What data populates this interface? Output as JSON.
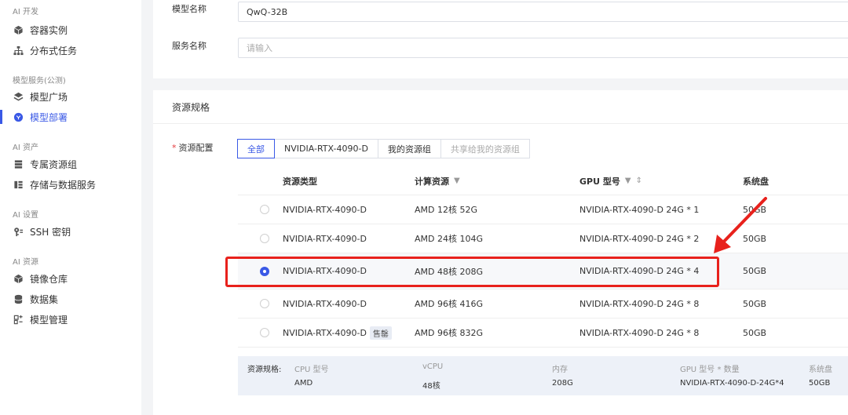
{
  "sidebar": {
    "groups": [
      {
        "label": "AI 开发",
        "items": [
          {
            "label": "容器实例",
            "icon": "cube-icon"
          },
          {
            "label": "分布式任务",
            "icon": "sitemap-icon"
          }
        ]
      },
      {
        "label": "模型服务(公测)",
        "items": [
          {
            "label": "模型广场",
            "icon": "layers-icon"
          },
          {
            "label": "模型部署",
            "icon": "deploy-icon",
            "active": true
          }
        ]
      },
      {
        "label": "AI 资产",
        "items": [
          {
            "label": "专属资源组",
            "icon": "server-icon"
          },
          {
            "label": "存储与数据服务",
            "icon": "storage-icon"
          }
        ]
      },
      {
        "label": "AI 设置",
        "items": [
          {
            "label": "SSH 密钥",
            "icon": "key-icon"
          }
        ]
      },
      {
        "label": "AI 资源",
        "items": [
          {
            "label": "镜像仓库",
            "icon": "box-icon"
          },
          {
            "label": "数据集",
            "icon": "database-icon"
          },
          {
            "label": "模型管理",
            "icon": "model-icon"
          }
        ]
      }
    ]
  },
  "form": {
    "model_name_label": "模型名称",
    "model_name_value": "QwQ-32B",
    "service_name_label": "服务名称",
    "service_name_placeholder": "请输入"
  },
  "resource": {
    "section_title": "资源规格",
    "config_label": "资源配置",
    "tabs": [
      {
        "label": "全部",
        "active": true
      },
      {
        "label": "NVIDIA-RTX-4090-D"
      },
      {
        "label": "我的资源组"
      },
      {
        "label": "共享给我的资源组",
        "disabled": true
      }
    ],
    "table": {
      "headers": {
        "type": "资源类型",
        "cpu": "计算资源",
        "gpu": "GPU 型号",
        "disk": "系统盘"
      },
      "rows": [
        {
          "type": "NVIDIA-RTX-4090-D",
          "cpu": "AMD 12核 52G",
          "gpu": "NVIDIA-RTX-4090-D 24G * 1",
          "disk": "50GB",
          "selected": false
        },
        {
          "type": "NVIDIA-RTX-4090-D",
          "cpu": "AMD 24核 104G",
          "gpu": "NVIDIA-RTX-4090-D 24G * 2",
          "disk": "50GB",
          "selected": false
        },
        {
          "type": "NVIDIA-RTX-4090-D",
          "cpu": "AMD 48核 208G",
          "gpu": "NVIDIA-RTX-4090-D 24G * 4",
          "disk": "50GB",
          "selected": true
        },
        {
          "type": "NVIDIA-RTX-4090-D",
          "cpu": "AMD 96核 416G",
          "gpu": "NVIDIA-RTX-4090-D 24G * 8",
          "disk": "50GB",
          "selected": false
        },
        {
          "type": "NVIDIA-RTX-4090-D",
          "badge": "售罄",
          "cpu": "AMD 96核 832G",
          "gpu": "NVIDIA-RTX-4090-D 24G * 8",
          "disk": "50GB",
          "selected": false
        }
      ]
    },
    "summary": {
      "title": "资源规格:",
      "headers": [
        "CPU 型号",
        "vCPU",
        "内存",
        "GPU 型号 * 数量",
        "系统盘"
      ],
      "values": [
        "AMD",
        "48核",
        "208G",
        "NVIDIA-RTX-4090-D-24G*4",
        "50GB"
      ]
    }
  },
  "colors": {
    "accent": "#3a59e6",
    "highlight": "#e8211c"
  }
}
